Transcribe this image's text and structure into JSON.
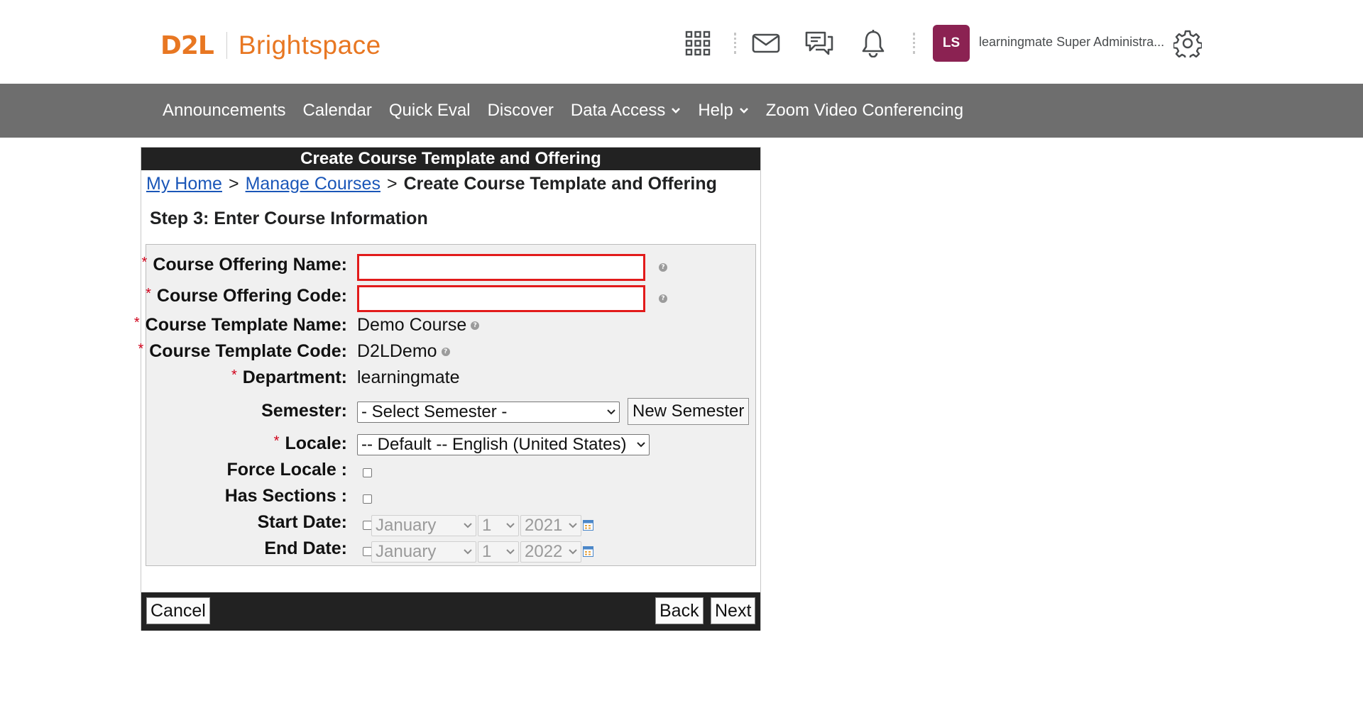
{
  "header": {
    "logo_d2l": "D2L",
    "logo_brightspace": "Brightspace",
    "avatar_initials": "LS",
    "user_name": "learningmate Super Administra...",
    "brand_color": "#e87722",
    "avatar_color": "#8b2252"
  },
  "nav": {
    "items": [
      {
        "label": "Announcements"
      },
      {
        "label": "Calendar"
      },
      {
        "label": "Quick Eval"
      },
      {
        "label": "Discover"
      },
      {
        "label": "Data Access"
      },
      {
        "label": "Help"
      },
      {
        "label": "Zoom Video Conferencing"
      }
    ]
  },
  "dialog": {
    "title": "Create Course Template and Offering",
    "breadcrumb": {
      "home": "My Home",
      "manage": "Manage Courses",
      "current": "Create Course Template and Offering",
      "sep": ">"
    },
    "step_title": "Step 3: Enter Course Information",
    "required_mark": "*",
    "fields": {
      "offering_name_label": "Course Offering Name:",
      "offering_name_value": "",
      "offering_code_label": "Course Offering Code:",
      "offering_code_value": "",
      "template_name_label": "Course Template Name:",
      "template_name_value": "Demo Course",
      "template_code_label": "Course Template Code:",
      "template_code_value": "D2LDemo",
      "department_label": "Department:",
      "department_value": "learningmate",
      "semester_label": "Semester:",
      "semester_selected": "- Select Semester -",
      "new_semester_button": "New Semester",
      "locale_label": "Locale:",
      "locale_selected": "-- Default -- English (United States)",
      "force_locale_label": "Force Locale :",
      "has_sections_label": "Has Sections :",
      "start_date_label": "Start Date:",
      "start_month": "January",
      "start_day": "1",
      "start_year": "2021",
      "end_date_label": "End Date:",
      "end_month": "January",
      "end_day": "1",
      "end_year": "2022"
    },
    "footer": {
      "cancel": "Cancel",
      "back": "Back",
      "next": "Next"
    }
  }
}
